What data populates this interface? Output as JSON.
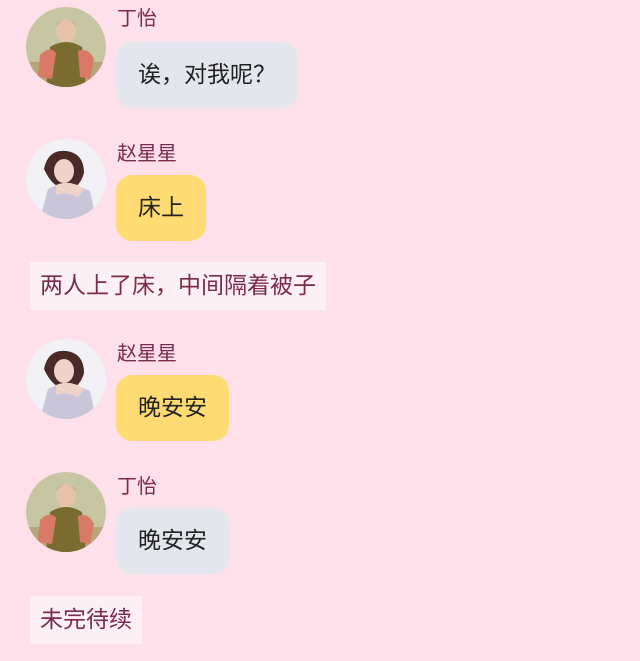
{
  "messages": [
    {
      "speaker": "丁怡",
      "text": "诶，对我呢？",
      "avatar_icon": "male-avatar-photo",
      "bubble_color": "#e4e6ee"
    },
    {
      "speaker": "赵星星",
      "text": "床上",
      "avatar_icon": "female-avatar-photo",
      "bubble_color": "#ffdc73"
    },
    {
      "speaker": "赵星星",
      "text": "晚安安",
      "avatar_icon": "female-avatar-photo",
      "bubble_color": "#ffdc73"
    },
    {
      "speaker": "丁怡",
      "text": "晚安安",
      "avatar_icon": "male-avatar-photo",
      "bubble_color": "#e4e6ee"
    }
  ],
  "narrations": [
    "两人上了床，中间隔着被子",
    "未完待续"
  ],
  "colors": {
    "background": "#fde0ea",
    "name_text": "#7a2a4a",
    "narration_bg": "#fdf0f4"
  }
}
